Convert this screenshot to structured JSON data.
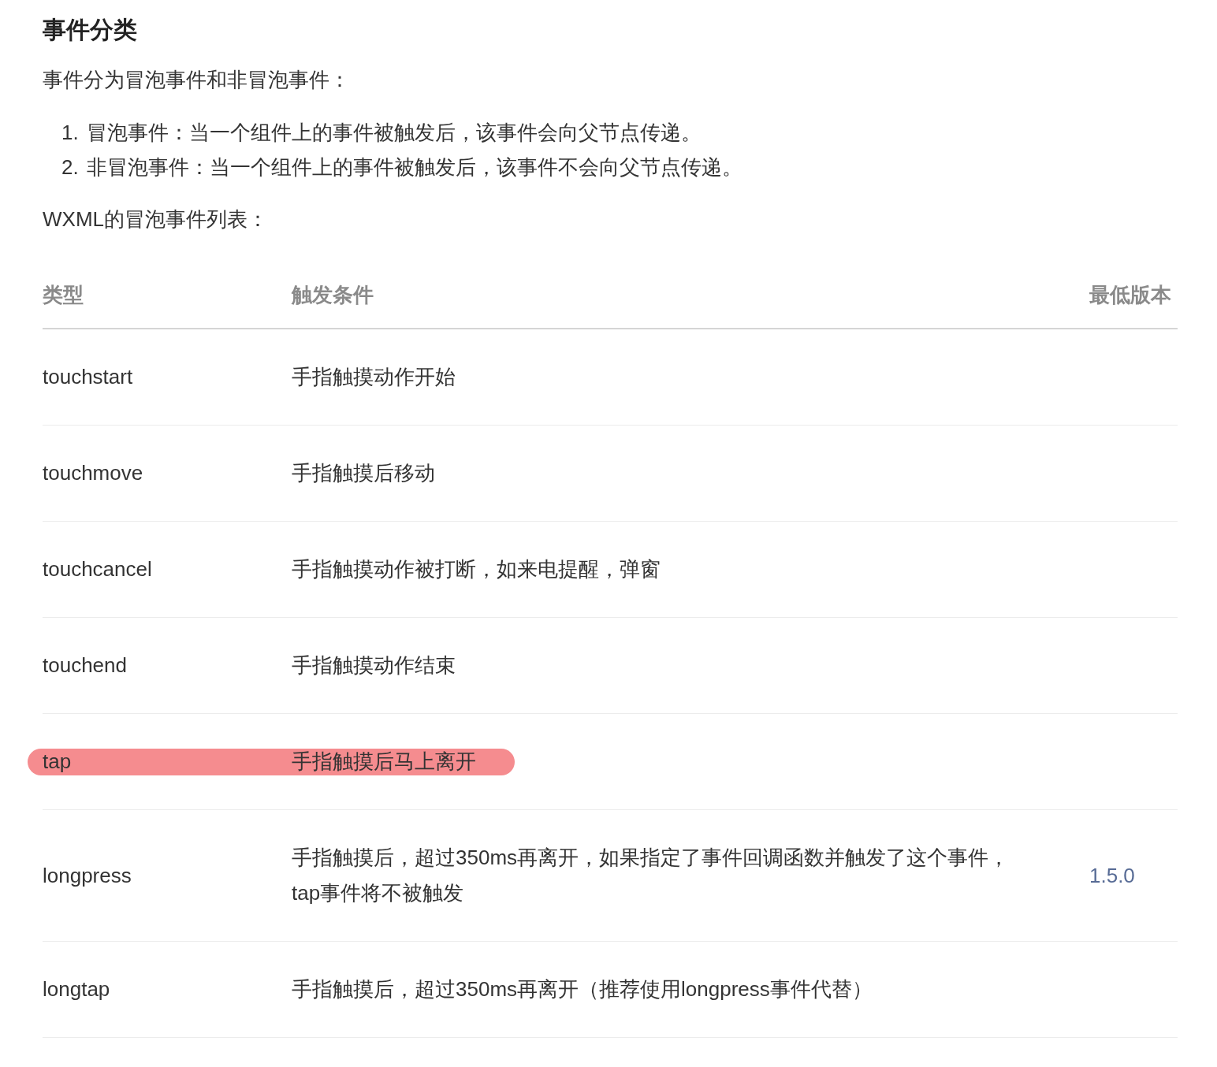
{
  "heading": "事件分类",
  "intro": "事件分为冒泡事件和非冒泡事件：",
  "list": [
    {
      "number": "1.",
      "text": "冒泡事件：当一个组件上的事件被触发后，该事件会向父节点传递。"
    },
    {
      "number": "2.",
      "text": "非冒泡事件：当一个组件上的事件被触发后，该事件不会向父节点传递。"
    }
  ],
  "table_caption": "WXML的冒泡事件列表：",
  "table": {
    "columns": [
      "类型",
      "触发条件",
      "最低版本"
    ],
    "rows": [
      {
        "type": "touchstart",
        "condition": "手指触摸动作开始",
        "highlighted": false
      },
      {
        "type": "touchmove",
        "condition": "手指触摸后移动",
        "highlighted": false
      },
      {
        "type": "touchcancel",
        "condition": "手指触摸动作被打断，如来电提醒，弹窗",
        "highlighted": false
      },
      {
        "type": "touchend",
        "condition": "手指触摸动作结束",
        "highlighted": false
      },
      {
        "type": "tap",
        "condition": "手指触摸后马上离开",
        "highlighted": true
      },
      {
        "type": "longpress",
        "condition": "手指触摸后，超过350ms再离开，如果指定了事件回调函数并触发了这个事件，tap事件将不被触发",
        "version": "1.5.0",
        "highlighted": false
      },
      {
        "type": "longtap",
        "condition": "手指触摸后，超过350ms再离开（推荐使用longpress事件代替）",
        "highlighted": false
      }
    ]
  }
}
